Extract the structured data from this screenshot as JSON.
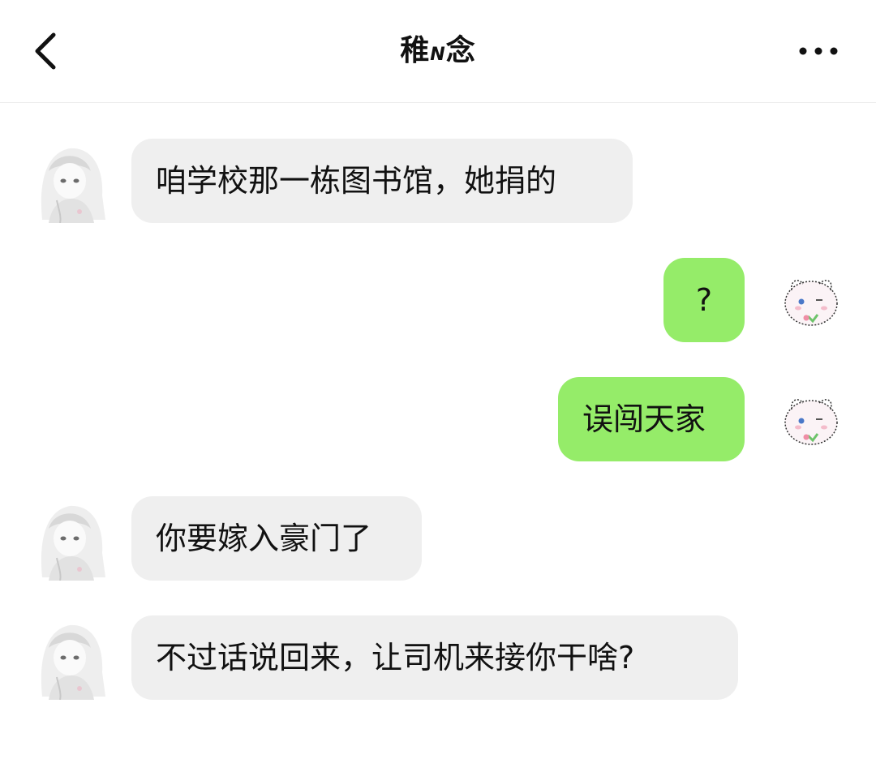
{
  "header": {
    "title_main_1": "稚",
    "title_sub": "N",
    "title_main_2": "念",
    "back_icon": "chevron-left-icon",
    "more_icon": "ellipsis-icon"
  },
  "messages": [
    {
      "side": "incoming",
      "text": "咱学校那一栋图书馆，她捐的"
    },
    {
      "side": "outgoing",
      "text": "?"
    },
    {
      "side": "outgoing",
      "text": "误闯天家"
    },
    {
      "side": "incoming",
      "text": "你要嫁入豪门了"
    },
    {
      "side": "incoming",
      "text": "不过话说回来，让司机来接你干啥?"
    }
  ],
  "colors": {
    "incoming_bubble": "#efefef",
    "outgoing_bubble": "#95ec69",
    "background": "#ffffff"
  }
}
